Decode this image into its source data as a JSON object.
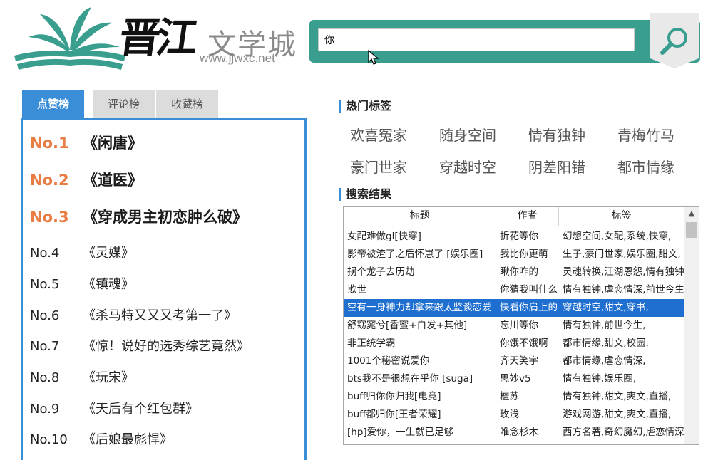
{
  "logo": {
    "brush": "晋江",
    "text": "文学城",
    "url": "www.jjwxc.net"
  },
  "search": {
    "value": "你"
  },
  "rank_tabs": [
    "点赞榜",
    "评论榜",
    "收藏榜"
  ],
  "ranking": [
    {
      "no": "No.1",
      "title": "《闲唐》"
    },
    {
      "no": "No.2",
      "title": "《道医》"
    },
    {
      "no": "No.3",
      "title": "《穿成男主初恋肿么破》"
    },
    {
      "no": "No.4",
      "title": "《灵媒》"
    },
    {
      "no": "No.5",
      "title": "《镇魂》"
    },
    {
      "no": "No.6",
      "title": "《杀马特又又又考第一了》"
    },
    {
      "no": "No.7",
      "title": "《惊！说好的选秀综艺竟然》"
    },
    {
      "no": "No.8",
      "title": "《玩宋》"
    },
    {
      "no": "No.9",
      "title": "《天后有个红包群》"
    },
    {
      "no": "No.10",
      "title": "《后娘最彪悍》"
    }
  ],
  "hot_tags": {
    "title": "热门标签",
    "tags": [
      "欢喜冤家",
      "随身空间",
      "情有独钟",
      "青梅竹马",
      "豪门世家",
      "穿越时空",
      "阴差阳错",
      "都市情缘"
    ]
  },
  "results": {
    "title": "搜索结果",
    "columns": [
      "标题",
      "作者",
      "标签"
    ],
    "rows": [
      [
        "女配难做gl[快穿]",
        "折花等你",
        "幻想空间,女配,系统,快穿,"
      ],
      [
        "影帝被渣了之后怀崽了 [娱乐圈]",
        "我比你更萌",
        "生子,豪门世家,娱乐圈,甜文,"
      ],
      [
        "拐个龙子去历劫",
        "瞅你咋的",
        "灵魂转换,江湖恩怨,情有独钟,"
      ],
      [
        "欺世",
        "你猜我叫什么",
        "情有独钟,虐恋情深,前世今生,"
      ],
      [
        "空有一身神力却拿来跟太监谈恋爱",
        "快看你肩上的",
        "穿越时空,甜文,穿书,"
      ],
      [
        "舒窈窕兮[香蜜+白发+其他]",
        "忘川等你",
        "情有独钟,前世今生,"
      ],
      [
        "非正统学霸",
        "你饿不饿啊",
        "都市情缘,甜文,校园,"
      ],
      [
        "1001个秘密说爱你",
        "齐天笑宇",
        "都市情缘,虐恋情深,"
      ],
      [
        "bts我不是很想在乎你 [suga]",
        "思妙v5",
        "情有独钟,娱乐圈,"
      ],
      [
        "buff归你你归我[电竞]",
        "檀苏",
        "情有独钟,甜文,爽文,直播,"
      ],
      [
        "buff都归你[王者荣耀]",
        "玫浅",
        "游戏网游,甜文,爽文,直播,"
      ],
      [
        "[hp]爱你，一生就已足够",
        "唯念杉木",
        "西方名著,奇幻魔幻,虐恋情深,"
      ]
    ],
    "selected_row": 4
  },
  "icons": {
    "search": "magnifier-icon",
    "cursor": "mouse-pointer-icon",
    "scroll_up": "chevron-up-icon",
    "logo": "book-leaf-logo"
  },
  "colors": {
    "accent_blue": "#3a8ed8",
    "teal": "#3a9e8f",
    "rank_orange": "#ea7d44",
    "selection": "#1f6fd0"
  }
}
